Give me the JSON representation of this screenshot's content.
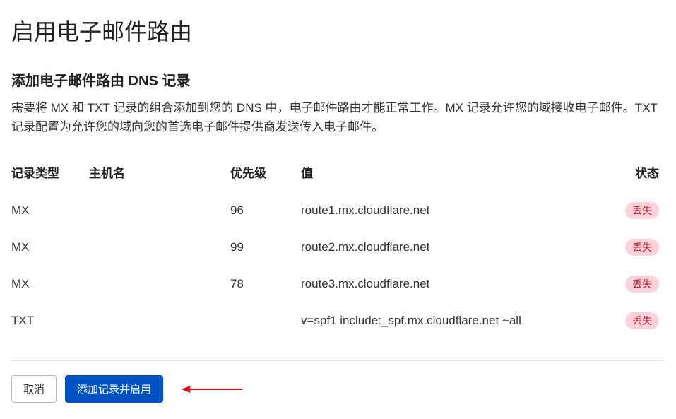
{
  "page": {
    "title": "启用电子邮件路由",
    "section_title": "添加电子邮件路由 DNS 记录",
    "description": "需要将 MX 和 TXT 记录的组合添加到您的 DNS 中，电子邮件路由才能正常工作。MX 记录允许您的域接收电子邮件。TXT 记录配置为允许您的域向您的首选电子邮件提供商发送传入电子邮件。"
  },
  "table": {
    "headers": {
      "type": "记录类型",
      "host": "主机名",
      "priority": "优先级",
      "value": "值",
      "status": "状态"
    },
    "rows": [
      {
        "type": "MX",
        "host": "",
        "priority": "96",
        "value": "route1.mx.cloudflare.net",
        "status": "丢失"
      },
      {
        "type": "MX",
        "host": "",
        "priority": "99",
        "value": "route2.mx.cloudflare.net",
        "status": "丢失"
      },
      {
        "type": "MX",
        "host": "",
        "priority": "78",
        "value": "route3.mx.cloudflare.net",
        "status": "丢失"
      },
      {
        "type": "TXT",
        "host": "",
        "priority": "",
        "value": "v=spf1 include:_spf.mx.cloudflare.net ~all",
        "status": "丢失"
      }
    ]
  },
  "buttons": {
    "cancel": "取消",
    "primary": "添加记录并启用"
  },
  "colors": {
    "primary": "#0051c3",
    "status_bg": "#fdd3d9",
    "status_fg": "#b82036",
    "arrow": "#e30613"
  }
}
